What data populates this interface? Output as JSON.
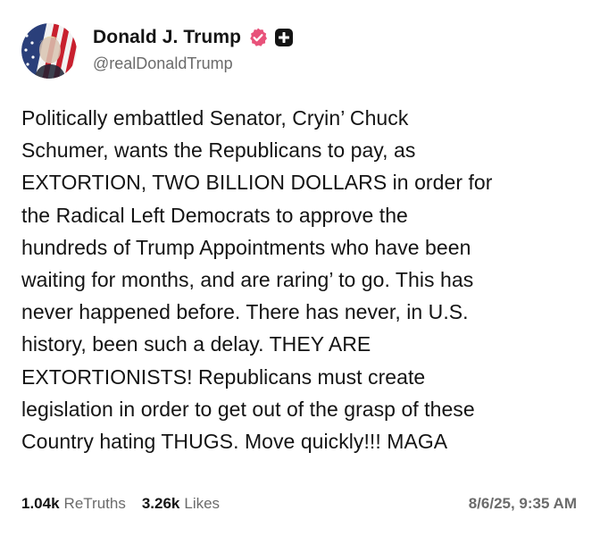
{
  "author": {
    "display_name": "Donald J. Trump",
    "handle": "@realDonaldTrump",
    "avatar_icon": "avatar-flag-portrait",
    "verified_icon": "verified-badge-icon",
    "verified_color": "#e8527a",
    "plus_icon": "plus-badge-icon"
  },
  "post": {
    "text": "Politically embattled Senator, Cryin’ Chuck\nSchumer, wants the Republicans to pay, as\nEXTORTION, TWO BILLION DOLLARS in order for\nthe Radical Left Democrats to approve the\nhundreds of Trump Appointments who have been\nwaiting for months, and are raring’ to go. This has\nnever happened before. There has never, in U.S.\nhistory, been such a delay. THEY ARE\nEXTORTIONISTS! Republicans must create\nlegislation in order to get out of the grasp of these\nCountry hating THUGS. Move quickly!!! MAGA"
  },
  "stats": {
    "retruths_count": "1.04k",
    "retruths_label": "ReTruths",
    "likes_count": "3.26k",
    "likes_label": "Likes"
  },
  "timestamp": "8/6/25, 9:35 AM",
  "colors": {
    "text": "#141414",
    "muted": "#6b6b6b",
    "badge_pink": "#e8527a"
  }
}
